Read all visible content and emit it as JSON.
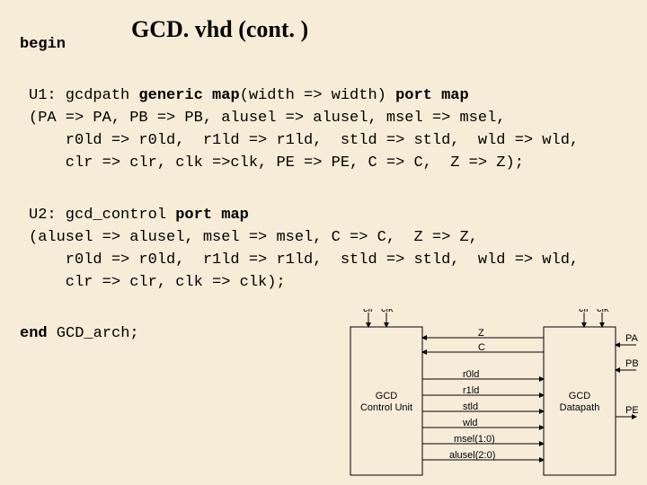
{
  "title": "GCD. vhd  (cont. )",
  "begin": "begin",
  "u1": {
    "l1_pre": "U1: gcdpath ",
    "l1_gm": "generic map",
    "l1_mid": "(width => width) ",
    "l1_pm": "port map",
    "l2": "(PA => PA, PB => PB, alusel => alusel, msel => msel,",
    "l3": "    r0ld => r0ld,  r1ld => r1ld,  stld => stld,  wld => wld,",
    "l4": "    clr => clr, clk =>clk, PE => PE, C => C,  Z => Z);"
  },
  "u2": {
    "l1_pre": "U2: gcd_control ",
    "l1_pm": "port map",
    "l2": "(alusel => alusel, msel => msel, C => C,  Z => Z,",
    "l3": "    r0ld => r0ld,  r1ld => r1ld,  stld => stld,  wld => wld,",
    "l4": "    clr => clr, clk => clk);"
  },
  "end_pre": "end",
  "end_post": " GCD_arch;",
  "diagram": {
    "left_top": [
      "clr",
      "clk"
    ],
    "right_top": [
      "clr",
      "clk"
    ],
    "control_box": [
      "GCD",
      "Control Unit"
    ],
    "datapath_box": [
      "GCD",
      "Datapath"
    ],
    "control_signals": [
      "Z",
      "C",
      "r0ld",
      "r1ld",
      "stld",
      "wld",
      "msel(1:0)",
      "alusel(2:0)"
    ],
    "right_in": [
      "PA",
      "PB"
    ],
    "right_out": "PE"
  }
}
